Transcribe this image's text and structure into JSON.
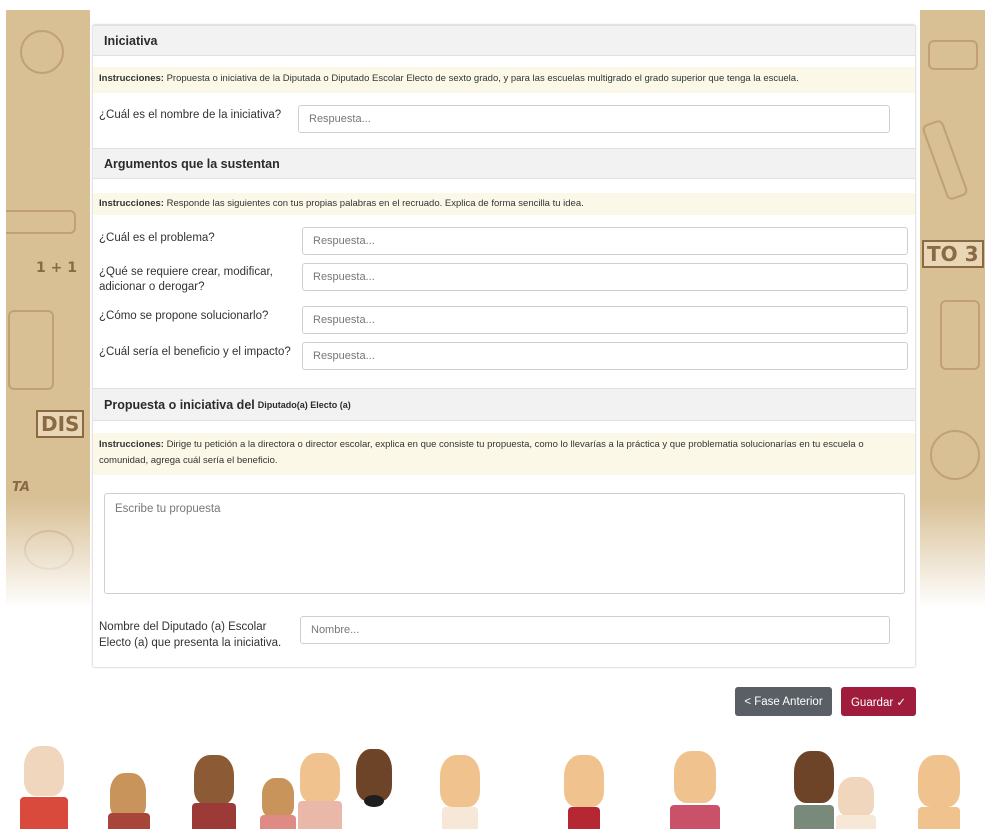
{
  "sections": {
    "iniciativa": {
      "title": "Iniciativa",
      "instr_label": "Instrucciones:",
      "instr_text": " Propuesta o iniciativa de la Diputada o Diputado Escolar Electo de sexto grado, y para las escuelas multigrado el grado superior que tenga la escuela.",
      "question": "¿Cuál es el nombre de la iniciativa?",
      "placeholder": "Respuesta..."
    },
    "argumentos": {
      "title": "Argumentos que la sustentan",
      "instr_label": "Instrucciones:",
      "instr_text": " Responde las siguientes con tus propias palabras en el recruado. Explica de forma sencilla tu idea.",
      "questions": [
        {
          "label": "¿Cuál es el problema?",
          "placeholder": "Respuesta..."
        },
        {
          "label": "¿Qué se requiere crear, modificar, adicionar o derogar?",
          "placeholder": "Respuesta..."
        },
        {
          "label": "¿Cómo se propone solucionarlo?",
          "placeholder": "Respuesta..."
        },
        {
          "label": "¿Cuál sería el beneficio y el impacto?",
          "placeholder": "Respuesta..."
        }
      ]
    },
    "propuesta": {
      "title": "Propuesta o iniciativa del",
      "title_suffix": "Diputado(a) Electo (a)",
      "instr_label": "Instrucciones:",
      "instr_text": " Dirige tu petición a la directora o director escolar, explica en que consiste tu propuesta, como lo llevarías a la práctica y que problematia solucionarías en tu escuela o comunidad, agrega cuál sería el beneficio.",
      "textarea_placeholder": "Escribe tu propuesta",
      "name_label": "Nombre del Diputado (a) Escolar Electo (a) que presenta la iniciativa.",
      "name_placeholder": "Nombre..."
    }
  },
  "buttons": {
    "prev_label": "< Fase Anterior",
    "save_label": "Guardar ✓"
  },
  "decor": {
    "right_text": "TO 3",
    "left_text_1": "DIS",
    "left_text_2": "TA",
    "left_text_3": "1 + 1"
  },
  "colors": {
    "accent": "#a01c3c",
    "secondary": "#5a5f66",
    "instr_bg": "#fbf8e8",
    "header_bg": "#f2f2f2",
    "band": "#d8bf94"
  }
}
